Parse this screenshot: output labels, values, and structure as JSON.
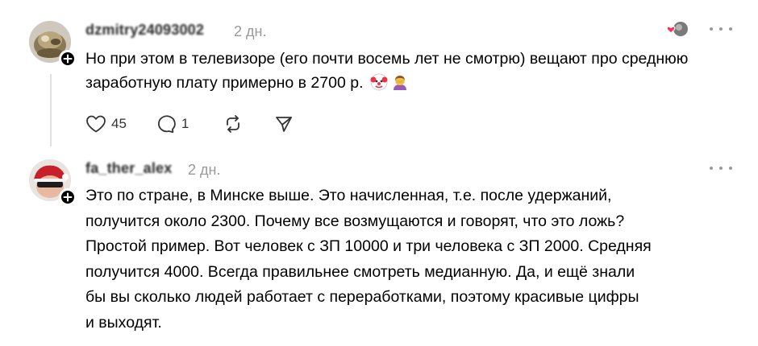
{
  "comments": [
    {
      "username": "dzmitry24093002",
      "time": "2 дн.",
      "text": "Но при этом в телевизоре (его почти восемь лет не смотрю) вещают про среднюю заработную плату примерно в 2700 р.",
      "emojis": [
        "clown-face",
        "person-facepalming"
      ],
      "likes": "45",
      "replies": "1"
    },
    {
      "username": "fa_ther_alex",
      "time": "2 дн.",
      "text_lines": [
        "Это по стране, в Минске выше. Это начисленная, т.е. после удержаний,",
        "получится около 2300. Почему все возмущаются и говорят, что это ложь?",
        "Простой пример. Вот человек с ЗП 10000 и три человека с ЗП 2000. Средняя",
        "получится 4000. Всегда правильнее смотреть медианную. Да, и ещё знали",
        "бы вы сколько людей работает с переработками, поэтому красивые цифры",
        "и выходят."
      ]
    }
  ],
  "colors": {
    "text": "#000000",
    "muted": "#999999",
    "like_heart": "#ff2d55",
    "thread_line": "#e0e0e0"
  }
}
